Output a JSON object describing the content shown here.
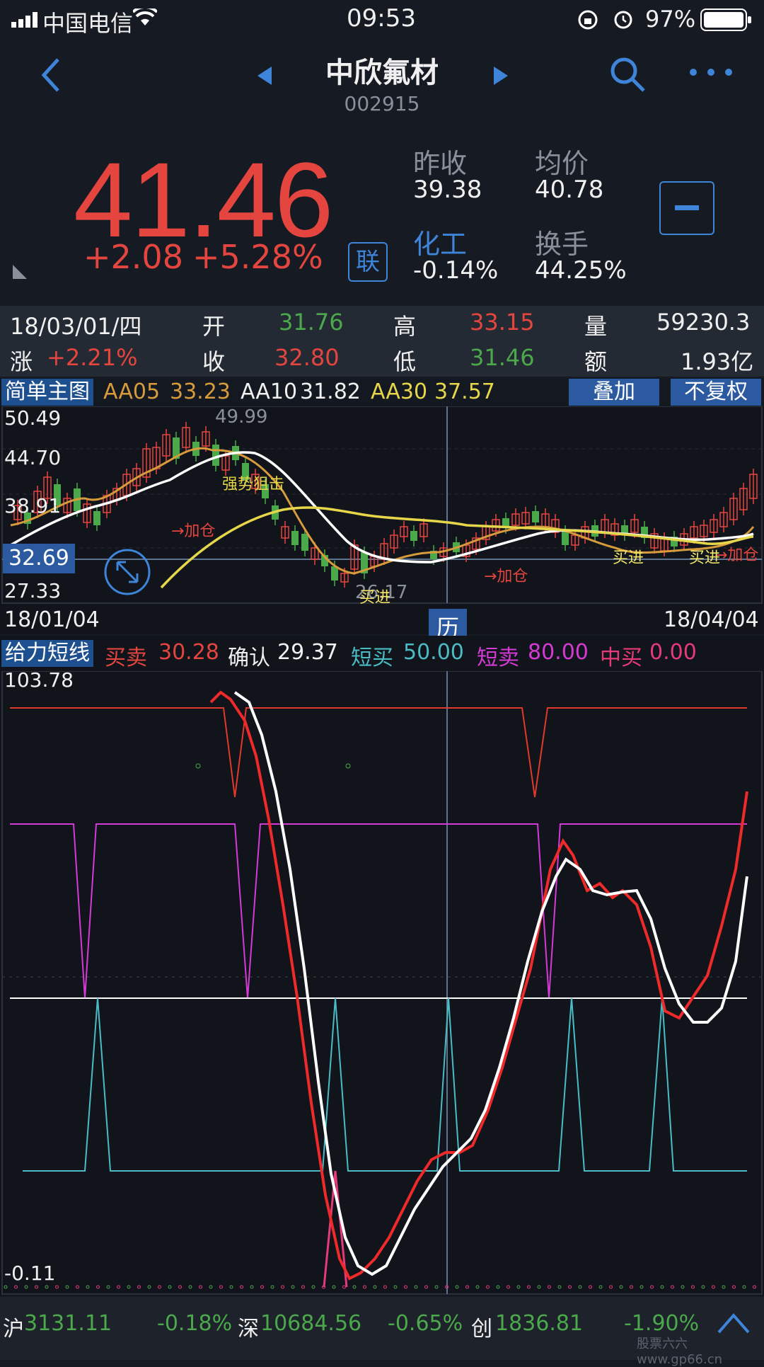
{
  "status_bar": {
    "carrier": "中国电信",
    "time": "09:53",
    "battery": "97%"
  },
  "nav": {
    "title": "中欣氟材",
    "code": "002915"
  },
  "quote": {
    "price": "41.46",
    "change": "+2.08",
    "change_pct": "+5.28%",
    "link_label": "联",
    "prev_close_label": "昨收",
    "prev_close": "39.38",
    "avg_label": "均价",
    "avg": "40.78",
    "sector_label": "化工",
    "sector_change": "-0.14%",
    "turnover_label": "换手",
    "turnover": "44.25%"
  },
  "kline_info": {
    "date": "18/03/01/四",
    "open_label": "开",
    "open": "31.76",
    "high_label": "高",
    "high": "33.15",
    "volume_label": "量",
    "volume": "59230.3",
    "rise_label": "涨",
    "rise": "+2.21%",
    "close_label": "收",
    "close": "32.80",
    "low_label": "低",
    "low": "31.46",
    "amount_label": "额",
    "amount": "1.93亿"
  },
  "main_chart": {
    "name": "简单主图",
    "aa05_label": "AA05",
    "aa05": "33.23",
    "aa10_label": "AA10",
    "aa10": "31.82",
    "aa30_label": "AA30",
    "aa30": "37.57",
    "overlay_button": "叠加",
    "adjust_button": "不复权",
    "y_top": "50.49",
    "y_2": "44.70",
    "y_3": "38.91",
    "y_bottom": "27.33",
    "cursor_value": "32.69",
    "peak_label": "49.99",
    "low_label": "26.17",
    "annotation_strong": "强势狙击",
    "annotation_add1": "→加仓",
    "annotation_add2": "→加仓",
    "annotation_add3": "→加仓",
    "annotation_buy1": "买进",
    "annotation_buy2": "买进",
    "annotation_buy3": "买进",
    "date_start": "18/01/04",
    "date_end": "18/04/04",
    "history_button": "历"
  },
  "indicator": {
    "name": "给力短线",
    "buysell_label": "买卖",
    "buysell": "30.28",
    "confirm_label": "确认",
    "confirm": "29.37",
    "short_buy_label": "短买",
    "short_buy": "50.00",
    "short_sell_label": "短卖",
    "short_sell": "80.00",
    "mid_buy_label": "中买",
    "mid_buy": "0.00",
    "y_top": "103.78",
    "y_bottom": "-0.11"
  },
  "index_bar": {
    "sh_label": "沪",
    "sh_value": "3131.11",
    "sh_change": "-0.18%",
    "sz_label": "深",
    "sz_value": "10684.56",
    "sz_change": "-0.65%",
    "cy_label": "创",
    "cy_value": "1836.81",
    "cy_change": "-1.90%",
    "watermark": "股票六六 www.gp66.cn"
  },
  "colors": {
    "up": "#e5453f",
    "down": "#4ba84b",
    "accent": "#3e84d8",
    "bg": "#161a22"
  }
}
